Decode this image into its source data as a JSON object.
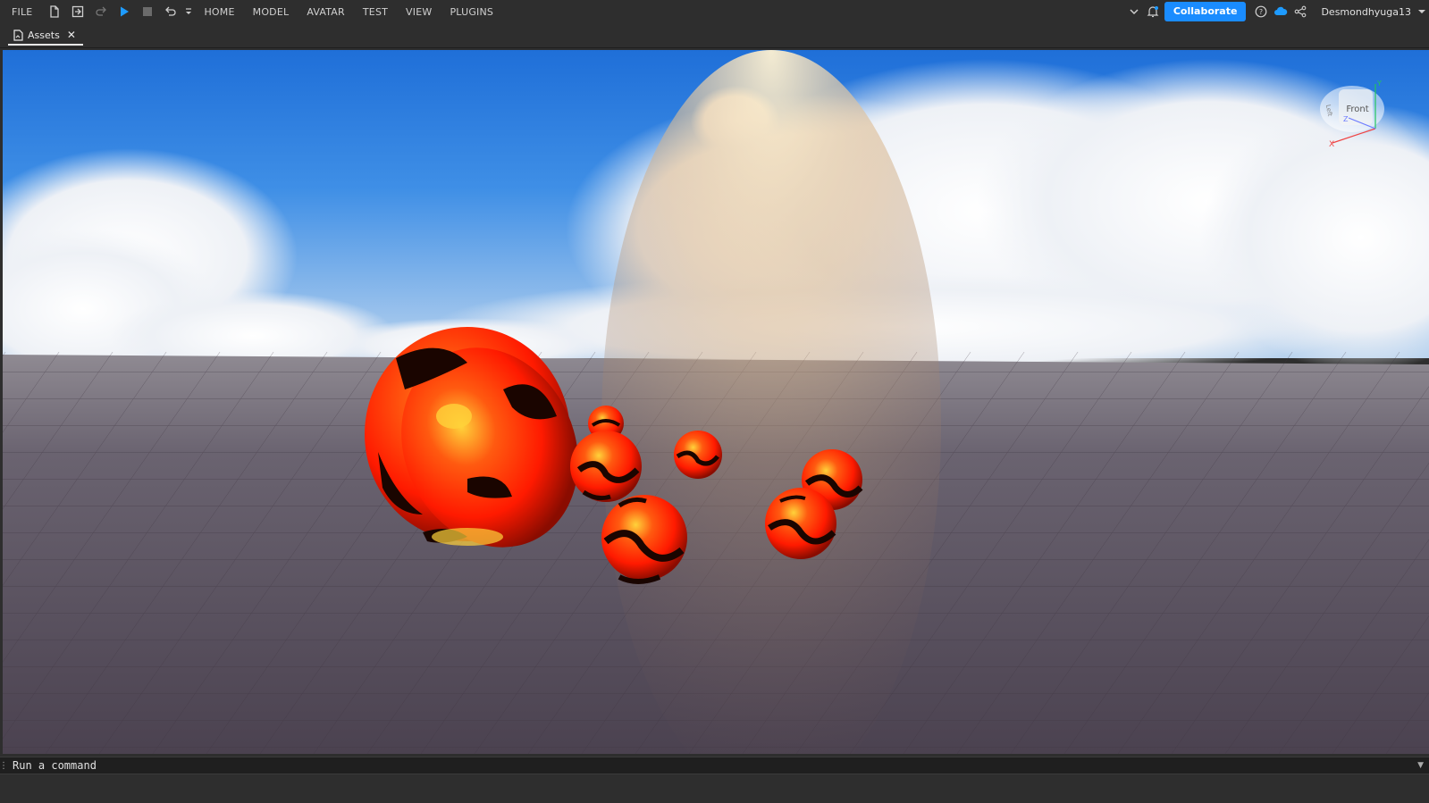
{
  "menubar": {
    "file": "FILE",
    "tabs": [
      "HOME",
      "MODEL",
      "AVATAR",
      "TEST",
      "VIEW",
      "PLUGINS"
    ]
  },
  "toolbar_icons": [
    "new-file-icon",
    "publish-icon",
    "redo-icon",
    "play-icon",
    "stop-icon",
    "undo-icon",
    "customize-dropdown-icon"
  ],
  "right_tools": {
    "collaborate_label": "Collaborate",
    "username": "Desmondhyuga13",
    "icons": [
      "chevron-down-icon",
      "notification-bell-icon",
      "help-icon",
      "cloud-icon",
      "share-icon"
    ]
  },
  "document_tabs": [
    {
      "label": "Assets",
      "icon": "document-icon"
    }
  ],
  "viewcube": {
    "front_label": "Front",
    "left_label": "Left",
    "axes": {
      "x": "X",
      "y": "Y",
      "z": "Z"
    }
  },
  "command_bar": {
    "placeholder": "Run a command"
  },
  "colors": {
    "accent": "#1a8cff",
    "chrome": "#2e2e2e",
    "lava_red": "#ff2a00",
    "lava_yellow": "#ffc400",
    "sky": "#2f7fe0"
  }
}
